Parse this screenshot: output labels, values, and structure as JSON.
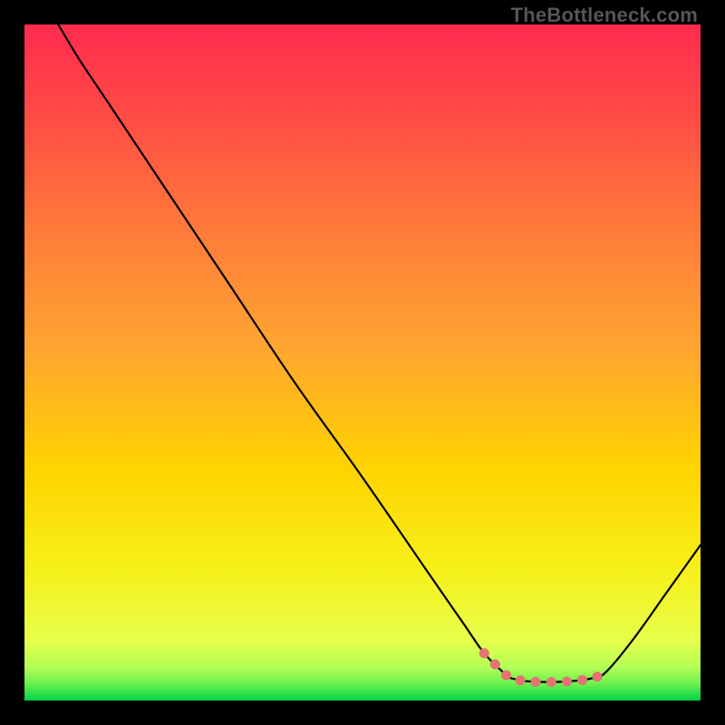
{
  "watermark": "TheBottleneck.com",
  "chart_data": {
    "type": "line",
    "title": "",
    "xlabel": "",
    "ylabel": "",
    "xlim": [
      0,
      100
    ],
    "ylim": [
      0,
      100
    ],
    "grid": false,
    "background_gradient": {
      "top": "#ff2b4f",
      "mid": "#ffd200",
      "bottom": "#00d34a"
    },
    "series": [
      {
        "name": "bottleneck-curve",
        "color": "#000000",
        "points": [
          {
            "x": 5.0,
            "y": 100.0
          },
          {
            "x": 8.0,
            "y": 95.0
          },
          {
            "x": 12.0,
            "y": 89.0
          },
          {
            "x": 20.0,
            "y": 77.0
          },
          {
            "x": 30.0,
            "y": 62.0
          },
          {
            "x": 40.0,
            "y": 47.0
          },
          {
            "x": 50.0,
            "y": 33.0
          },
          {
            "x": 60.0,
            "y": 18.5
          },
          {
            "x": 65.0,
            "y": 11.3
          },
          {
            "x": 68.0,
            "y": 7.0
          },
          {
            "x": 71.0,
            "y": 4.0
          },
          {
            "x": 72.0,
            "y": 3.3
          },
          {
            "x": 75.0,
            "y": 2.8
          },
          {
            "x": 80.0,
            "y": 2.8
          },
          {
            "x": 84.0,
            "y": 3.3
          },
          {
            "x": 86.0,
            "y": 4.2
          },
          {
            "x": 90.0,
            "y": 9.0
          },
          {
            "x": 95.0,
            "y": 16.0
          },
          {
            "x": 100.0,
            "y": 23.0
          }
        ]
      }
    ],
    "highlight_segment": {
      "name": "low-bottleneck-zone",
      "color": "#e57373",
      "x_range": [
        68,
        86
      ],
      "points": [
        {
          "x": 68.0,
          "y": 7.0
        },
        {
          "x": 71.0,
          "y": 4.0
        },
        {
          "x": 72.0,
          "y": 3.3
        },
        {
          "x": 75.0,
          "y": 2.8
        },
        {
          "x": 80.0,
          "y": 2.8
        },
        {
          "x": 84.0,
          "y": 3.3
        },
        {
          "x": 86.0,
          "y": 4.2
        }
      ]
    }
  }
}
